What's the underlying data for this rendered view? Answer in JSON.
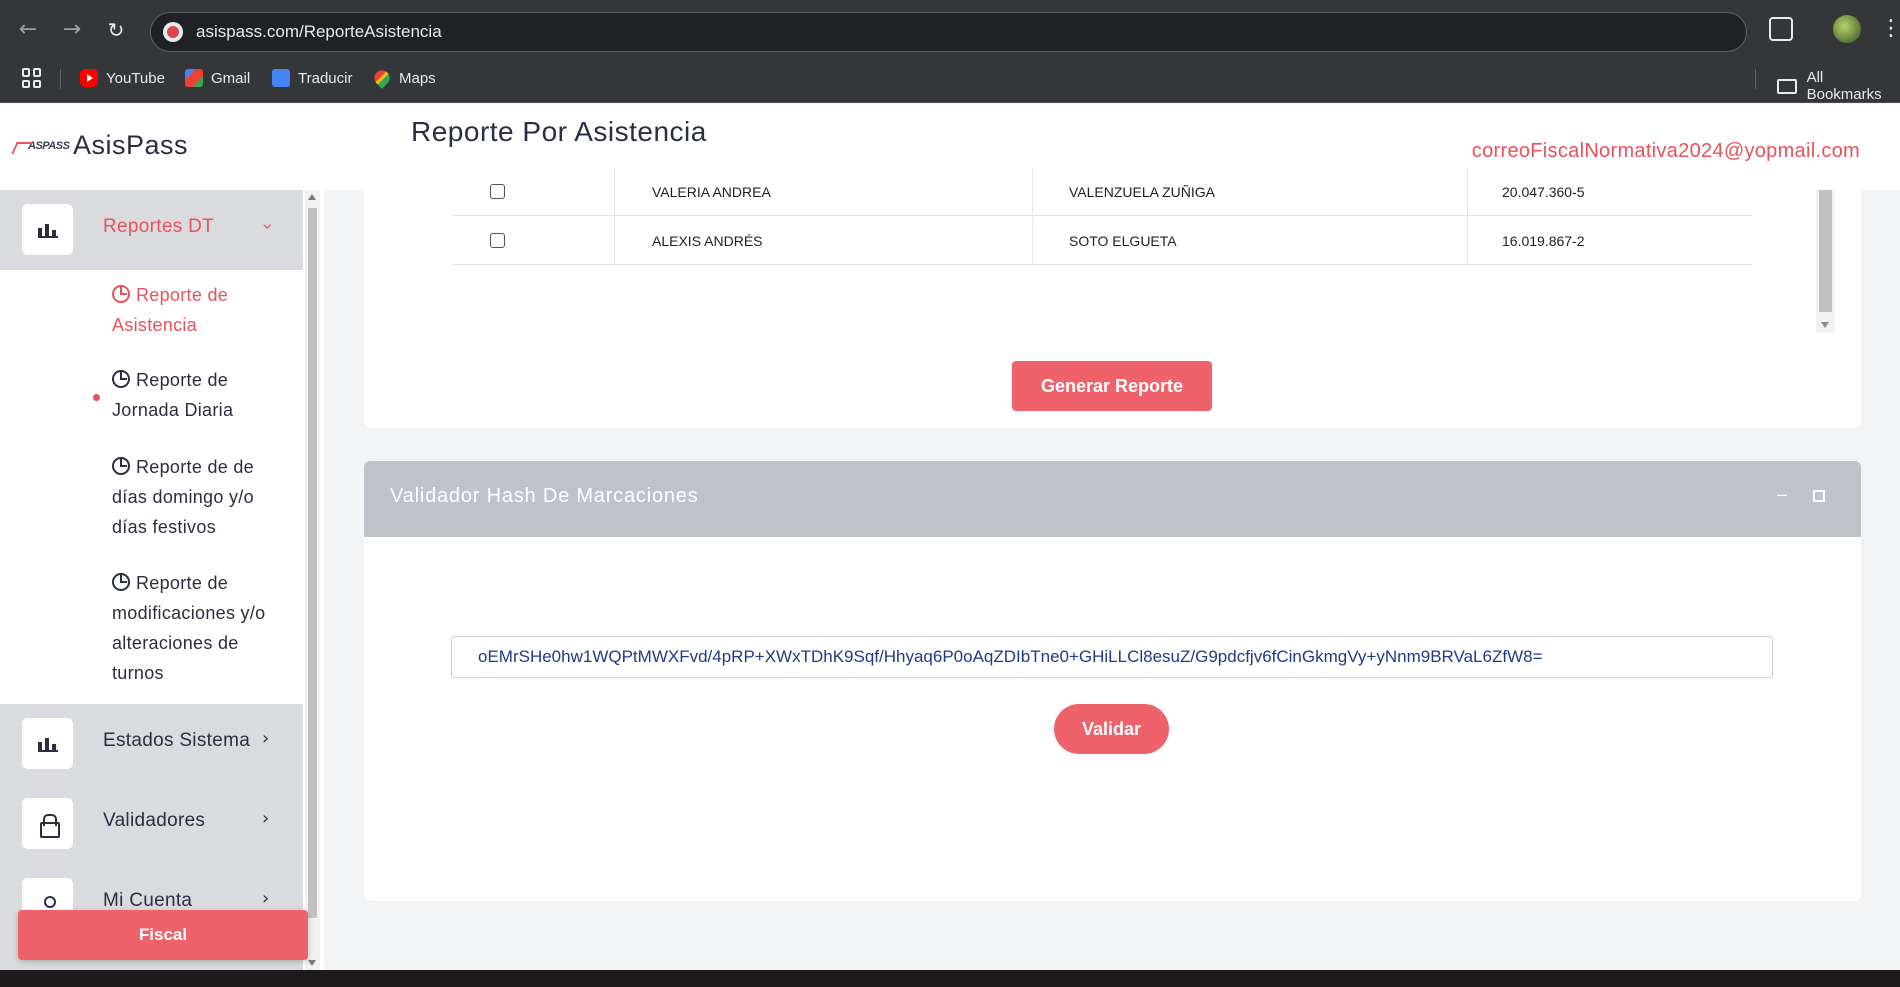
{
  "browser": {
    "url": "asispass.com/ReporteAsistencia",
    "bookmarks": [
      {
        "label": "YouTube",
        "icon": "youtube-icon"
      },
      {
        "label": "Gmail",
        "icon": "gmail-icon"
      },
      {
        "label": "Traducir",
        "icon": "translate-icon"
      },
      {
        "label": "Maps",
        "icon": "maps-icon"
      }
    ],
    "all_bookmarks_label": "All Bookmarks"
  },
  "brand": {
    "logo_text": "ASPASS",
    "name": "AsisPass"
  },
  "sidebar": {
    "groups": [
      {
        "label": "Reportes DT",
        "icon": "bar-chart-icon",
        "expanded": true
      },
      {
        "label": "Estados Sistema",
        "icon": "bar-chart-icon"
      },
      {
        "label": "Validadores",
        "icon": "lock-icon"
      },
      {
        "label": "Mi Cuenta",
        "icon": "user-icon"
      }
    ],
    "submenu": [
      {
        "label": "Reporte de Asistencia",
        "icon": "clock-icon",
        "active": true
      },
      {
        "label": "Reporte de Jornada Diaria",
        "icon": "clock-icon"
      },
      {
        "label": "Reporte de de días domingo y/o días festivos",
        "icon": "clock-icon"
      },
      {
        "label": "Reporte de modificaciones y/o alteraciones de turnos",
        "icon": "clock-icon"
      }
    ],
    "fiscal_button": "Fiscal"
  },
  "header": {
    "title": "Reporte Por Asistencia",
    "user_email": "correoFiscalNormativa2024@yopmail.com"
  },
  "employees": {
    "rows": [
      {
        "nombres": "VALERIA ANDREA",
        "apellidos": "VALENZUELA ZUÑIGA",
        "rut": "20.047.360-5"
      },
      {
        "nombres": "ALEXIS ANDRÉS",
        "apellidos": "SOTO ELGUETA",
        "rut": "16.019.867-2"
      }
    ],
    "generate_button": "Generar Reporte"
  },
  "hash_validator": {
    "title": "Validador Hash De Marcaciones",
    "minimize": "–",
    "hash_value": "oEMrSHe0hw1WQPtMWXFvd/4pRP+XWxTDhK9Sqf/Hhyaq6P0oAqZDIbTne0+GHiLLCl8esuZ/G9pdcfjv6fCinGkmgVy+yNnm9BRVaL6ZfW8=",
    "validate_button": "Validar"
  },
  "colors": {
    "accent": "#f0626b",
    "header_gray": "#bfc2c9",
    "text_dark": "#2b2d42"
  }
}
